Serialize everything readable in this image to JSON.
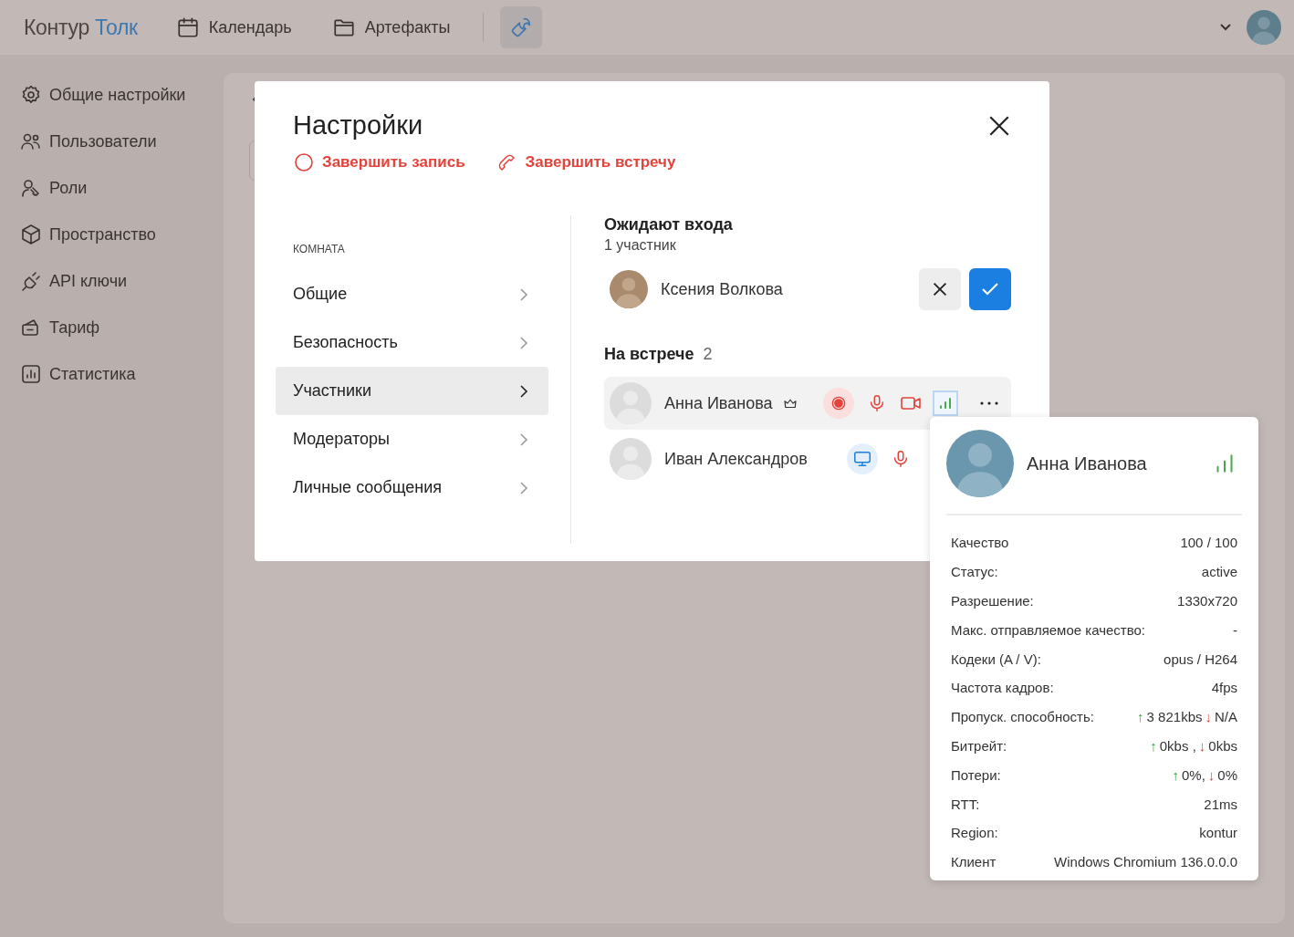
{
  "topbar": {
    "logo": {
      "brand": "Контур",
      "product": "Толк"
    },
    "nav": [
      {
        "kind": "calendar",
        "label": "Календарь"
      },
      {
        "kind": "folder",
        "label": "Артефакты"
      }
    ],
    "tools_button": {
      "selected": true
    }
  },
  "sidebar": {
    "items": [
      {
        "kind": "gear",
        "label": "Общие настройки"
      },
      {
        "kind": "users",
        "label": "Пользователи"
      },
      {
        "kind": "roles",
        "label": "Роли"
      },
      {
        "kind": "cube",
        "label": "Пространство"
      },
      {
        "kind": "plug",
        "label": "API ключи"
      },
      {
        "kind": "wallet",
        "label": "Тариф"
      },
      {
        "kind": "chart",
        "label": "Статистика"
      }
    ]
  },
  "modal": {
    "title": "Настройки",
    "actions": [
      {
        "kind": "record",
        "label": "Завершить запись"
      },
      {
        "kind": "phone",
        "label": "Завершить встречу"
      }
    ],
    "menu": {
      "section": "КОМНАТА",
      "items": [
        {
          "label": "Общие",
          "selected": false
        },
        {
          "label": "Безопасность",
          "selected": false
        },
        {
          "label": "Участники",
          "selected": true
        },
        {
          "label": "Модераторы",
          "selected": false
        },
        {
          "label": "Личные сообщения",
          "selected": false
        }
      ]
    },
    "waiting": {
      "title": "Ожидают входа",
      "count": "1 участник",
      "people": [
        {
          "name": "Ксения Волкова"
        }
      ]
    },
    "in_meeting": {
      "title": "На встрече",
      "count": "2",
      "participants": [
        {
          "name": "Анна Иванова",
          "selected": true,
          "indicators": [
            {
              "kind": "crown"
            },
            {
              "kind": "recording"
            },
            {
              "kind": "mic"
            },
            {
              "kind": "camera"
            },
            {
              "kind": "signal",
              "selected": true
            },
            {
              "kind": "more"
            }
          ]
        },
        {
          "name": "Иван Александров",
          "selected": false,
          "indicators": [
            {
              "kind": "screen"
            },
            {
              "kind": "mic"
            }
          ]
        }
      ]
    }
  },
  "popup": {
    "name": "Анна Иванова",
    "stats": [
      {
        "label": "Качество",
        "value": [
          {
            "kind": "plain",
            "text": "100 / 100"
          }
        ]
      },
      {
        "label": "Статус:",
        "value": [
          {
            "kind": "plain",
            "text": "active"
          }
        ]
      },
      {
        "label": "Разрешение:",
        "value": [
          {
            "kind": "plain",
            "text": "1330x720"
          }
        ]
      },
      {
        "label": "Макс. отправляемое качество:",
        "value": [
          {
            "kind": "plain",
            "text": "-"
          }
        ]
      },
      {
        "label": "Кодеки (A / V):",
        "value": [
          {
            "kind": "plain",
            "text": "opus / H264"
          }
        ]
      },
      {
        "label": "Частота кадров:",
        "value": [
          {
            "kind": "plain",
            "text": "4fps"
          }
        ]
      },
      {
        "label": "Пропуск. способность:",
        "value": [
          {
            "kind": "up",
            "text": "↑"
          },
          {
            "kind": "plain",
            "text": "3 821kbs"
          },
          {
            "kind": "down",
            "text": "↓"
          },
          {
            "kind": "plain",
            "text": "N/A"
          }
        ]
      },
      {
        "label": "Битрейт:",
        "value": [
          {
            "kind": "up",
            "text": "↑"
          },
          {
            "kind": "plain",
            "text": "0kbs ,"
          },
          {
            "kind": "down",
            "text": "↓"
          },
          {
            "kind": "plain",
            "text": "0kbs"
          }
        ]
      },
      {
        "label": "Потери:",
        "value": [
          {
            "kind": "up",
            "text": "↑"
          },
          {
            "kind": "plain",
            "text": "0%,"
          },
          {
            "kind": "down",
            "text": "↓"
          },
          {
            "kind": "plain",
            "text": "0%"
          }
        ]
      },
      {
        "label": "RTT:",
        "value": [
          {
            "kind": "plain",
            "text": "21ms"
          }
        ]
      },
      {
        "label": "Region:",
        "value": [
          {
            "kind": "plain",
            "text": "kontur"
          }
        ]
      },
      {
        "label": "Клиент",
        "value": [
          {
            "kind": "plain",
            "text": "Windows Chromium 136.0.0.0"
          }
        ]
      }
    ]
  }
}
